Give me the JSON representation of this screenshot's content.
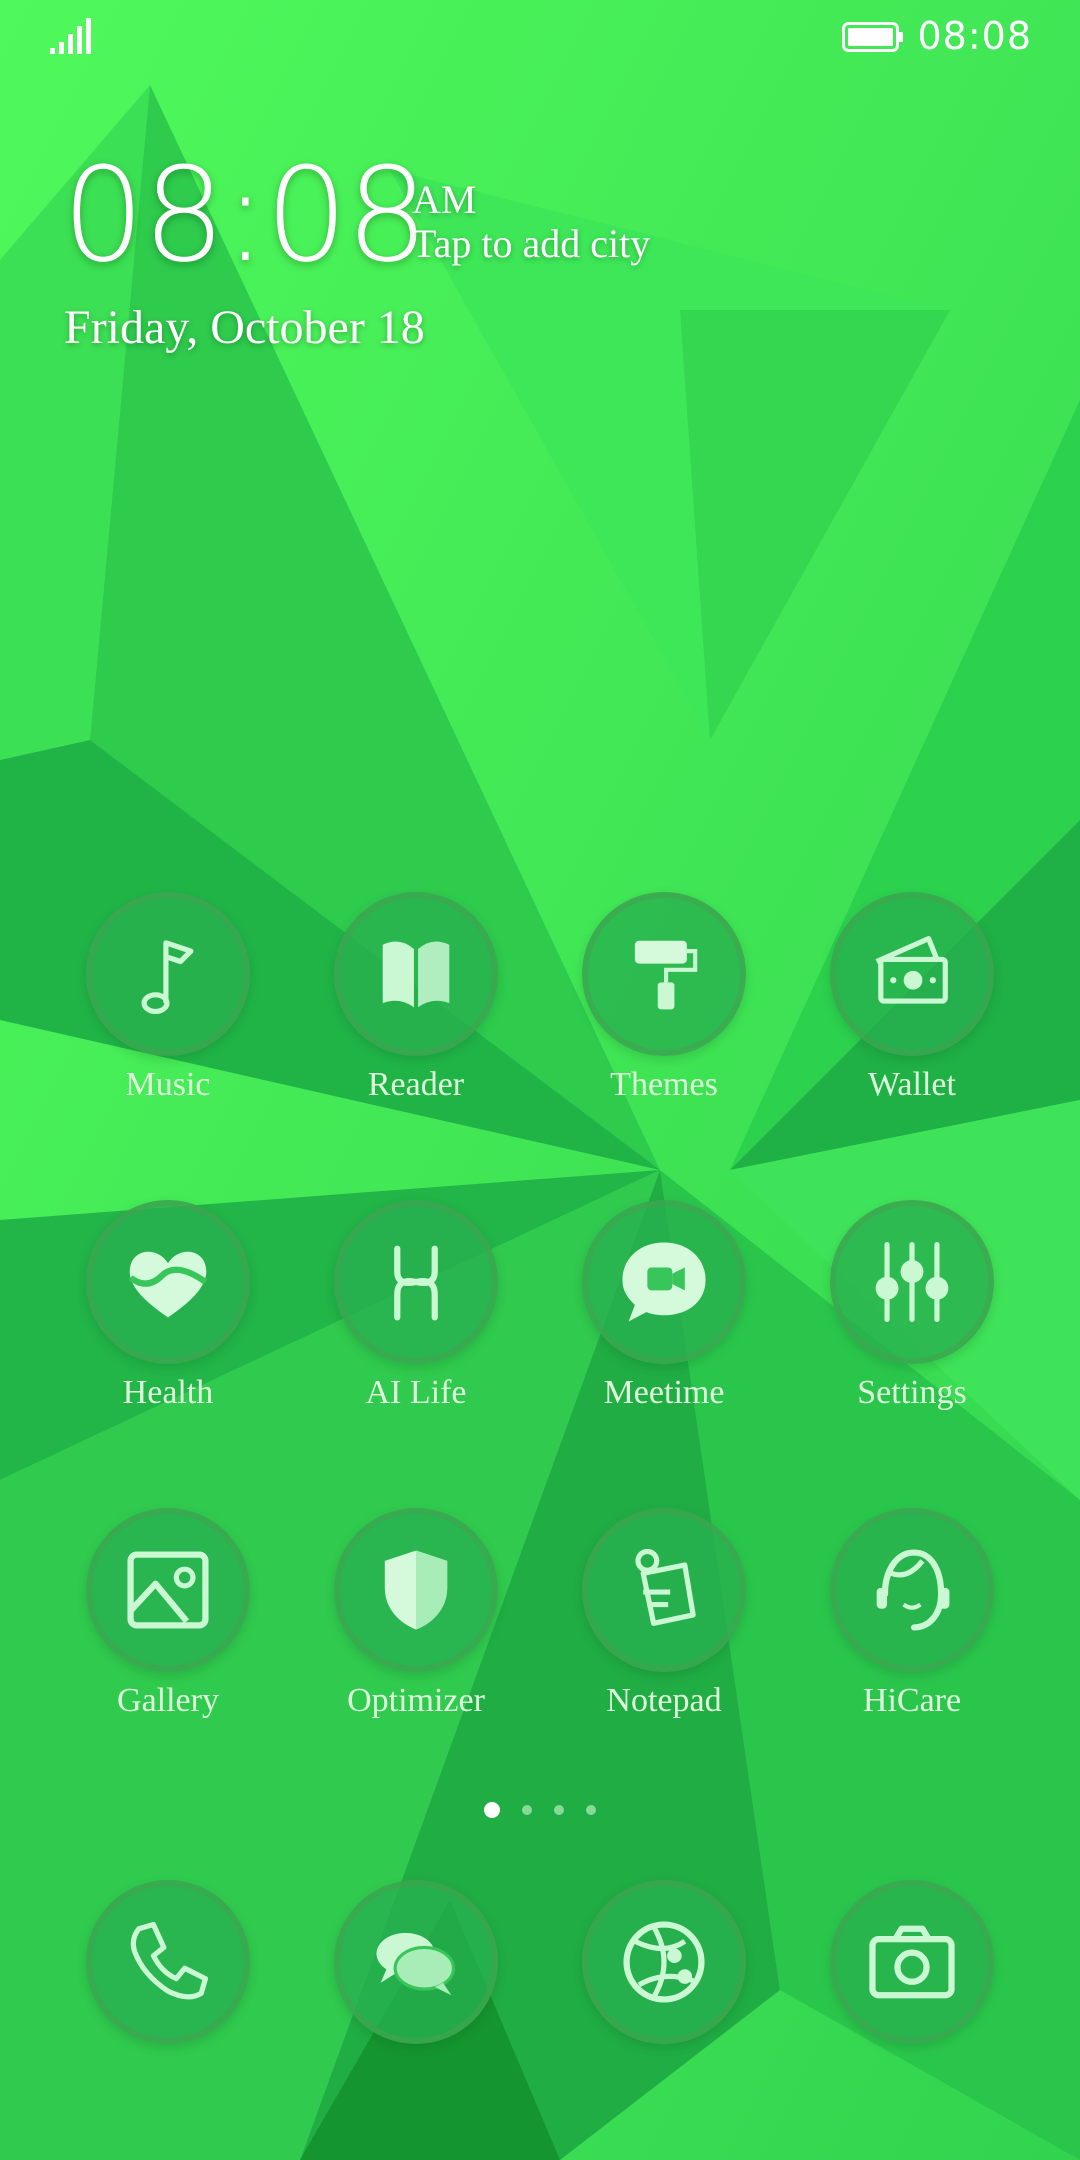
{
  "status_bar": {
    "time": "08:08",
    "signal_icon": "signal-bars-icon",
    "battery_icon": "battery-full-icon"
  },
  "clock": {
    "time": "08:08",
    "ampm": "AM",
    "city_prompt": "Tap to add city",
    "date": "Friday, October 18"
  },
  "home_apps": [
    {
      "label": "Music",
      "icon": "music-note-icon"
    },
    {
      "label": "Reader",
      "icon": "open-book-icon"
    },
    {
      "label": "Themes",
      "icon": "paint-roller-icon"
    },
    {
      "label": "Wallet",
      "icon": "wallet-cash-icon"
    },
    {
      "label": "Health",
      "icon": "heart-icon"
    },
    {
      "label": "AI Life",
      "icon": "ai-life-icon"
    },
    {
      "label": "Meetime",
      "icon": "video-chat-icon"
    },
    {
      "label": "Settings",
      "icon": "sliders-icon"
    },
    {
      "label": "Gallery",
      "icon": "image-icon"
    },
    {
      "label": "Optimizer",
      "icon": "shield-icon"
    },
    {
      "label": "Notepad",
      "icon": "notepad-icon"
    },
    {
      "label": "HiCare",
      "icon": "headset-icon"
    }
  ],
  "page_indicator": {
    "pages": 4,
    "current": 1
  },
  "dock": [
    {
      "name": "phone",
      "icon": "phone-icon"
    },
    {
      "name": "messages",
      "icon": "message-bubbles-icon"
    },
    {
      "name": "browser",
      "icon": "globe-icon"
    },
    {
      "name": "camera",
      "icon": "camera-icon"
    }
  ],
  "colors": {
    "wallpaper_light": "#4dfa5a",
    "wallpaper_dark": "#1a9c3a",
    "icon_fill": "#b8f5c4",
    "text": "#dfffdc"
  }
}
